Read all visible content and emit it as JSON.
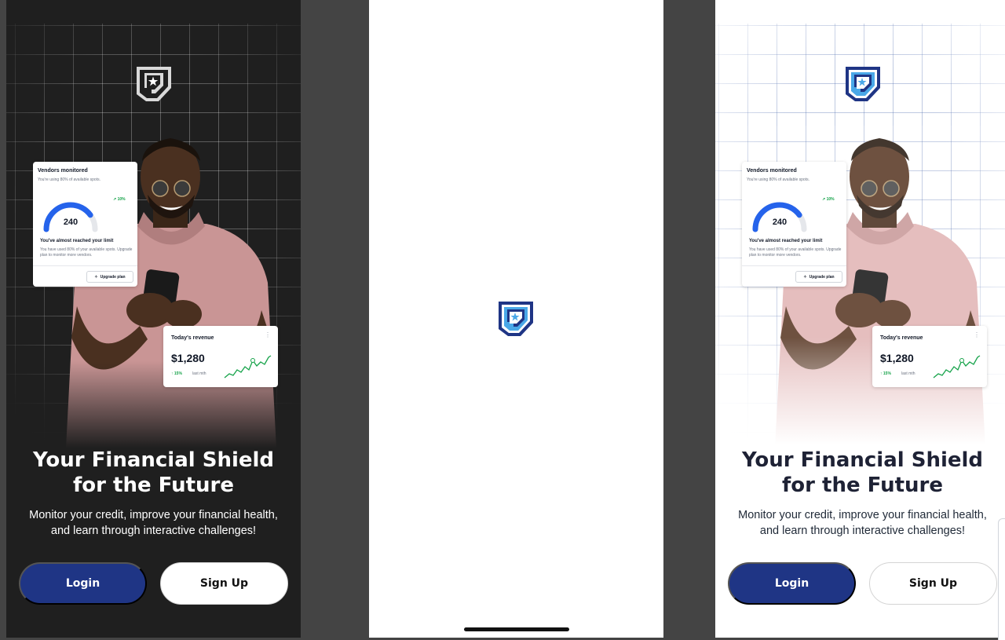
{
  "onboarding_dark": {
    "vendors_card": {
      "title": "Vendors monitored",
      "subtitle": "You're using 80% of available spots.",
      "gauge_value": "240",
      "gauge_fill": 0.8,
      "trend": "↗ 10%",
      "limit_title": "You've almost reached your limit",
      "limit_body": "You have used 80% of your available spots. Upgrade plan to monitor more vendors.",
      "upgrade_button": "Upgrade plan"
    },
    "revenue_card": {
      "title": "Today's revenue",
      "amount": "$1,280",
      "change": "↑ 15%",
      "period": "last mth"
    },
    "headline_line1": "Your Financial Shield",
    "headline_line2": "for the Future",
    "subtext_line1": "Monitor your credit, improve your financial health,",
    "subtext_line2": "and learn through interactive challenges!",
    "login_button": "Login",
    "signup_button": "Sign Up"
  },
  "onboarding_light": {
    "vendors_card": {
      "title": "Vendors monitored",
      "subtitle": "You're using 80% of available spots.",
      "gauge_value": "240",
      "gauge_fill": 0.8,
      "trend": "↗ 10%",
      "limit_title": "You've almost reached your limit",
      "limit_body": "You have used 80% of your available spots. Upgrade plan to monitor more vendors.",
      "upgrade_button": "Upgrade plan"
    },
    "revenue_card": {
      "title": "Today's revenue",
      "amount": "$1,280",
      "change": "↑ 15%",
      "period": "last mth"
    },
    "headline_line1": "Your Financial Shield",
    "headline_line2": "for the Future",
    "subtext_line1": "Monitor your credit, improve your financial health,",
    "subtext_line2": "and learn through interactive challenges!",
    "login_button": "Login",
    "signup_button": "Sign Up"
  },
  "icons": {
    "logo": "shield-star-logo-icon",
    "upgrade": "sparkle-icon",
    "menu": "kebab-menu-icon"
  },
  "colors": {
    "brand_navy": "#1f3585",
    "logo_light_blue": "#4aa8e8",
    "dark_background": "#1f1f1f",
    "gauge_blue": "#2563eb",
    "positive_green": "#16a34a"
  }
}
